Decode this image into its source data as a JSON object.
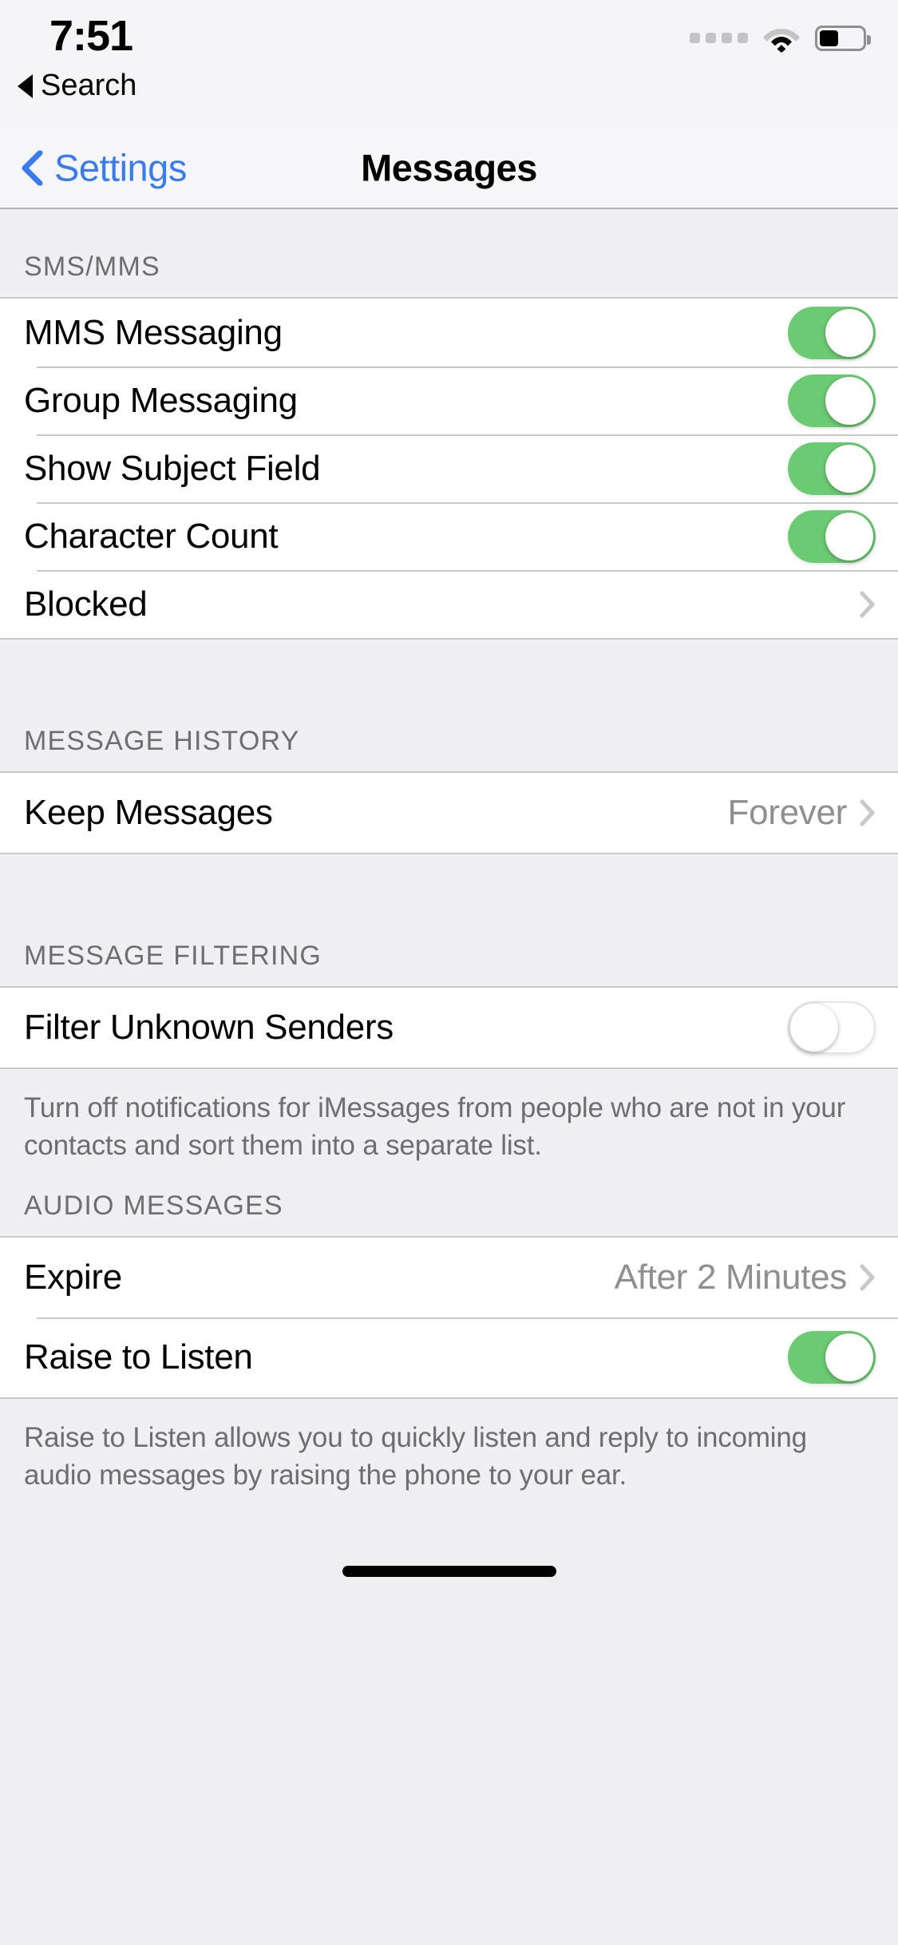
{
  "status_bar": {
    "time": "7:51",
    "back_label": "Search",
    "back_icon": "triangle-left-icon",
    "signal_icon": "signal-dots-icon",
    "wifi_icon": "wifi-icon",
    "battery_icon": "battery-icon",
    "battery_level_percent": 45
  },
  "nav": {
    "back_label": "Settings",
    "back_icon": "chevron-left-icon",
    "title": "Messages"
  },
  "colors": {
    "accent_blue": "#3A7BEF",
    "toggle_on_green": "#6BCB72",
    "group_background": "#FFFFFF",
    "page_background": "#EFEFF4",
    "secondary_text": "#8E8E93",
    "header_text": "#6D6D72",
    "separator": "#C8C7CC"
  },
  "sections": [
    {
      "header": "SMS/MMS",
      "rows": [
        {
          "label": "MMS Messaging",
          "type": "toggle",
          "value": "on"
        },
        {
          "label": "Group Messaging",
          "type": "toggle",
          "value": "on"
        },
        {
          "label": "Show Subject Field",
          "type": "toggle",
          "value": "on"
        },
        {
          "label": "Character Count",
          "type": "toggle",
          "value": "on"
        },
        {
          "label": "Blocked",
          "type": "disclosure",
          "value": "",
          "chevron_icon": "chevron-right-icon"
        }
      ],
      "footer": ""
    },
    {
      "header": "MESSAGE HISTORY",
      "rows": [
        {
          "label": "Keep Messages",
          "type": "disclosure",
          "value": "Forever",
          "chevron_icon": "chevron-right-icon"
        }
      ],
      "footer": ""
    },
    {
      "header": "MESSAGE FILTERING",
      "rows": [
        {
          "label": "Filter Unknown Senders",
          "type": "toggle",
          "value": "off"
        }
      ],
      "footer": "Turn off notifications for iMessages from people who are not in your contacts and sort them into a separate list."
    },
    {
      "header": "AUDIO MESSAGES",
      "rows": [
        {
          "label": "Expire",
          "type": "disclosure",
          "value": "After 2 Minutes",
          "chevron_icon": "chevron-right-icon"
        },
        {
          "label": "Raise to Listen",
          "type": "toggle",
          "value": "on"
        }
      ],
      "footer": "Raise to Listen allows you to quickly listen and reply to incoming audio messages by raising the phone to your ear."
    }
  ]
}
